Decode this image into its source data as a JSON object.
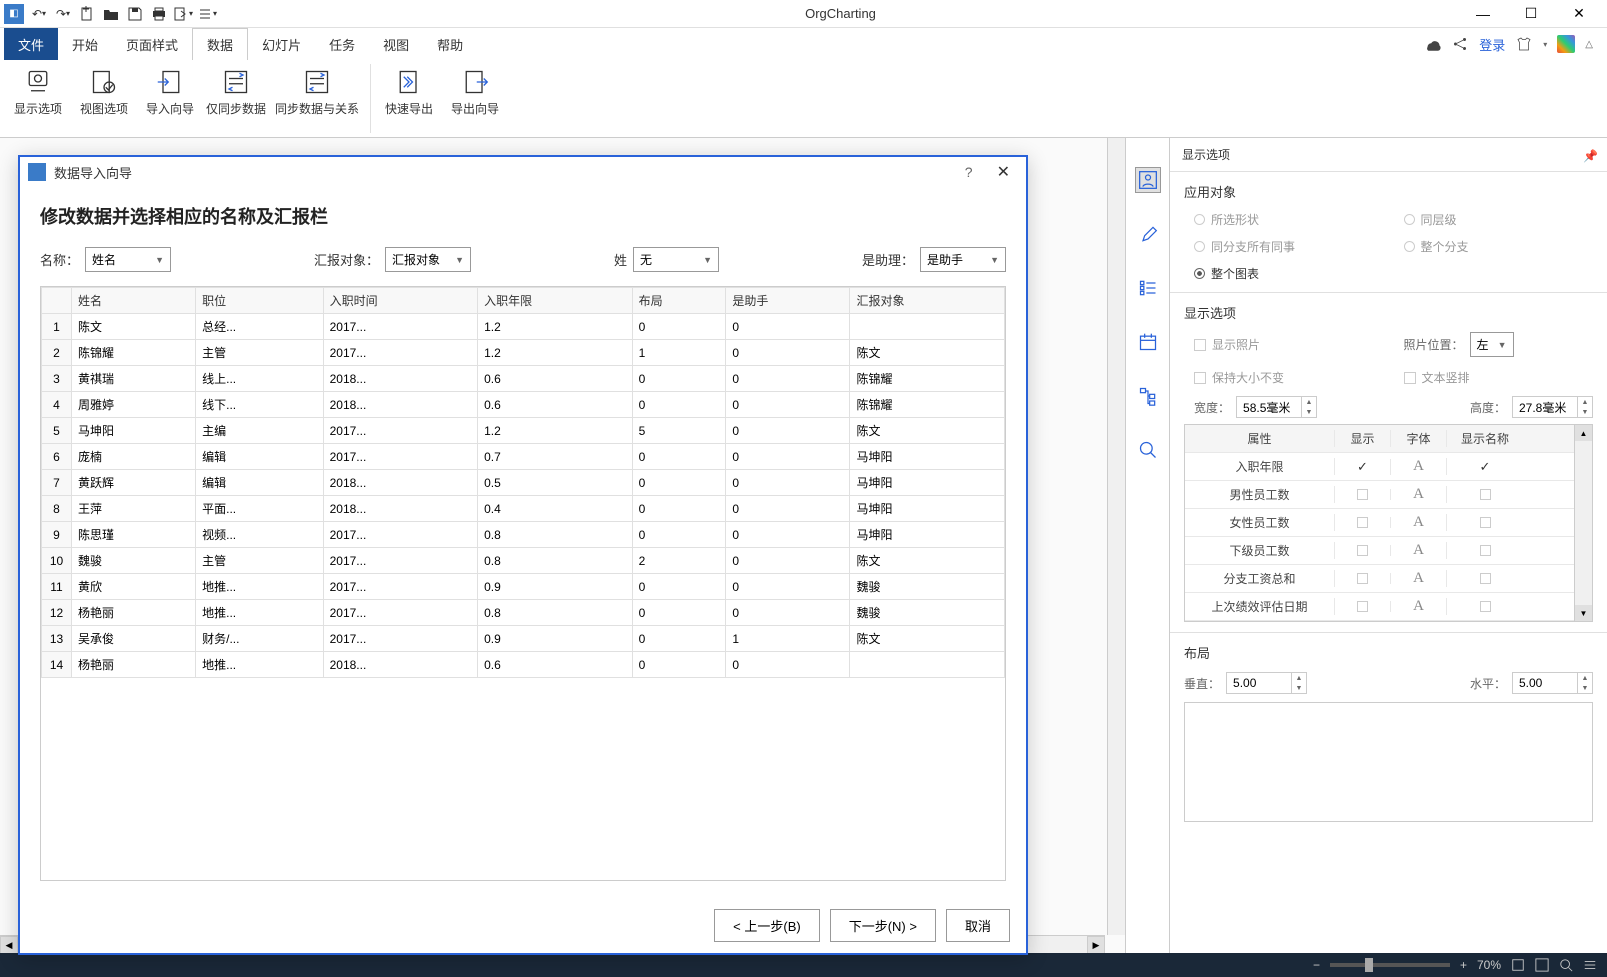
{
  "app": {
    "title": "OrgCharting"
  },
  "qat_icons": [
    "undo",
    "redo",
    "new",
    "open",
    "save",
    "print",
    "export",
    "list"
  ],
  "menu": {
    "file": "文件",
    "tabs": [
      "开始",
      "页面样式",
      "数据",
      "幻灯片",
      "任务",
      "视图",
      "帮助"
    ],
    "active": "数据",
    "login": "登录"
  },
  "ribbon": {
    "group1": [
      {
        "id": "display-options",
        "label": "显示选项"
      },
      {
        "id": "view-options",
        "label": "视图选项"
      },
      {
        "id": "import-wizard",
        "label": "导入向导"
      },
      {
        "id": "sync-data-only",
        "label": "仅同步数据"
      },
      {
        "id": "sync-data-relations",
        "label": "同步数据与关系"
      }
    ],
    "group2": [
      {
        "id": "quick-export",
        "label": "快速导出"
      },
      {
        "id": "export-wizard",
        "label": "导出向导"
      }
    ]
  },
  "dialog": {
    "title": "数据导入向导",
    "heading": "修改数据并选择相应的名称及汇报栏",
    "controls": {
      "name_label": "名称：",
      "name_value": "姓名",
      "report_label": "汇报对象：",
      "report_value": "汇报对象",
      "surname_label": "姓",
      "surname_value": "无",
      "assist_label": "是助理：",
      "assist_value": "是助手"
    },
    "columns": [
      "",
      "姓名",
      "职位",
      "入职时间",
      "入职年限",
      "布局",
      "是助手",
      "汇报对象"
    ],
    "rows": [
      {
        "n": 1,
        "name": "陈文",
        "pos": "总经...",
        "date": "2017...",
        "yrs": "1.2",
        "layout": "0",
        "assist": "0",
        "report": ""
      },
      {
        "n": 2,
        "name": "陈锦耀",
        "pos": "主管",
        "date": "2017...",
        "yrs": "1.2",
        "layout": "1",
        "assist": "0",
        "report": "陈文"
      },
      {
        "n": 3,
        "name": "黄祺瑞",
        "pos": "线上...",
        "date": "2018...",
        "yrs": "0.6",
        "layout": "0",
        "assist": "0",
        "report": "陈锦耀"
      },
      {
        "n": 4,
        "name": "周雅婷",
        "pos": "线下...",
        "date": "2018...",
        "yrs": "0.6",
        "layout": "0",
        "assist": "0",
        "report": "陈锦耀"
      },
      {
        "n": 5,
        "name": "马坤阳",
        "pos": "主编",
        "date": "2017...",
        "yrs": "1.2",
        "layout": "5",
        "assist": "0",
        "report": "陈文"
      },
      {
        "n": 6,
        "name": "庞楠",
        "pos": "编辑",
        "date": "2017...",
        "yrs": "0.7",
        "layout": "0",
        "assist": "0",
        "report": "马坤阳"
      },
      {
        "n": 7,
        "name": "黄跃辉",
        "pos": "编辑",
        "date": "2018...",
        "yrs": "0.5",
        "layout": "0",
        "assist": "0",
        "report": "马坤阳"
      },
      {
        "n": 8,
        "name": "王萍",
        "pos": "平面...",
        "date": "2018...",
        "yrs": "0.4",
        "layout": "0",
        "assist": "0",
        "report": "马坤阳"
      },
      {
        "n": 9,
        "name": "陈思瑾",
        "pos": "视频...",
        "date": "2017...",
        "yrs": "0.8",
        "layout": "0",
        "assist": "0",
        "report": "马坤阳"
      },
      {
        "n": 10,
        "name": "魏骏",
        "pos": "主管",
        "date": "2017...",
        "yrs": "0.8",
        "layout": "2",
        "assist": "0",
        "report": "陈文"
      },
      {
        "n": 11,
        "name": "黄欣",
        "pos": "地推...",
        "date": "2017...",
        "yrs": "0.9",
        "layout": "0",
        "assist": "0",
        "report": "魏骏"
      },
      {
        "n": 12,
        "name": "杨艳丽",
        "pos": "地推...",
        "date": "2017...",
        "yrs": "0.8",
        "layout": "0",
        "assist": "0",
        "report": "魏骏"
      },
      {
        "n": 13,
        "name": "吴承俊",
        "pos": "财务/...",
        "date": "2017...",
        "yrs": "0.9",
        "layout": "0",
        "assist": "1",
        "report": "陈文"
      },
      {
        "n": 14,
        "name": "杨艳丽",
        "pos": "地推...",
        "date": "2018...",
        "yrs": "0.6",
        "layout": "0",
        "assist": "0",
        "report": ""
      }
    ],
    "buttons": {
      "prev": "< 上一步(B)",
      "next": "下一步(N) >",
      "cancel": "取消"
    }
  },
  "panel": {
    "title": "显示选项",
    "apply": {
      "header": "应用对象",
      "options": [
        "所选形状",
        "同层级",
        "同分支所有同事",
        "整个分支",
        "整个图表"
      ],
      "selected": "整个图表"
    },
    "display": {
      "header": "显示选项",
      "checks": [
        "显示照片",
        "保持大小不变",
        "文本竖排"
      ],
      "photo_pos_label": "照片位置：",
      "photo_pos_value": "左",
      "width_label": "宽度：",
      "width_value": "58.5毫米",
      "height_label": "高度：",
      "height_value": "27.8毫米"
    },
    "attr_table": {
      "headers": [
        "属性",
        "显示",
        "字体",
        "显示名称"
      ],
      "rows": [
        {
          "name": "入职年限",
          "show": true,
          "showName": true
        },
        {
          "name": "男性员工数",
          "show": false,
          "showName": false
        },
        {
          "name": "女性员工数",
          "show": false,
          "showName": false
        },
        {
          "name": "下级员工数",
          "show": false,
          "showName": false
        },
        {
          "name": "分支工资总和",
          "show": false,
          "showName": false
        },
        {
          "name": "上次绩效评估日期",
          "show": false,
          "showName": false
        }
      ]
    },
    "layout": {
      "header": "布局",
      "v_label": "垂直：",
      "v_value": "5.00",
      "h_label": "水平：",
      "h_value": "5.00"
    }
  },
  "status": {
    "zoom": "70%"
  }
}
